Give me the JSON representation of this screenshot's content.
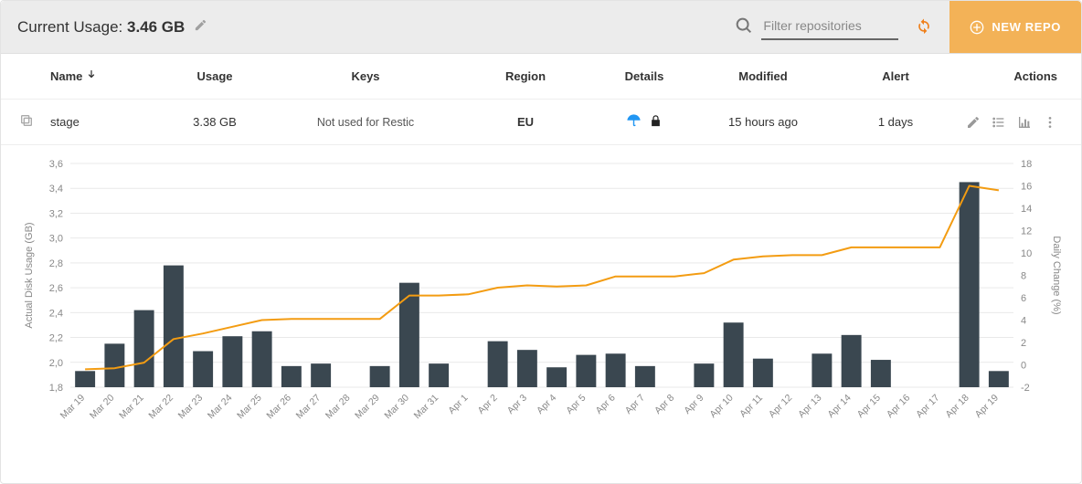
{
  "header": {
    "title_prefix": "Current Usage: ",
    "usage_value": "3.46 GB",
    "search_placeholder": "Filter repositories",
    "new_repo_label": "NEW REPO"
  },
  "columns": {
    "name": "Name",
    "usage": "Usage",
    "keys": "Keys",
    "region": "Region",
    "details": "Details",
    "modified": "Modified",
    "alert": "Alert",
    "actions": "Actions"
  },
  "row": {
    "name": "stage",
    "usage": "3.38 GB",
    "keys": "Not used for Restic",
    "region": "EU",
    "modified": "15 hours ago",
    "alert": "1 days"
  },
  "chart_data": {
    "type": "bar",
    "title": "",
    "xlabel": "",
    "ylabel_left": "Actual Disk Usage (GB)",
    "ylabel_right": "Daily Change (%)",
    "ylim_left": [
      1.8,
      3.6
    ],
    "ylim_right": [
      -2,
      18
    ],
    "categories": [
      "Mar 19",
      "Mar 20",
      "Mar 21",
      "Mar 22",
      "Mar 23",
      "Mar 24",
      "Mar 25",
      "Mar 26",
      "Mar 27",
      "Mar 28",
      "Mar 29",
      "Mar 30",
      "Mar 31",
      "Apr 1",
      "Apr 2",
      "Apr 3",
      "Apr 4",
      "Apr 5",
      "Apr 6",
      "Apr 7",
      "Apr 8",
      "Apr 9",
      "Apr 10",
      "Apr 11",
      "Apr 12",
      "Apr 13",
      "Apr 14",
      "Apr 15",
      "Apr 16",
      "Apr 17",
      "Apr 18",
      "Apr 19"
    ],
    "series": [
      {
        "name": "Actual Disk Usage (GB)",
        "type": "bar",
        "axis": "left",
        "values": [
          1.93,
          2.15,
          2.42,
          2.78,
          2.09,
          2.21,
          2.25,
          1.97,
          1.99,
          null,
          1.97,
          2.64,
          1.99,
          null,
          2.17,
          2.1,
          1.96,
          2.06,
          2.07,
          1.97,
          null,
          1.99,
          2.32,
          2.03,
          null,
          2.07,
          2.22,
          2.02,
          null,
          null,
          3.45,
          1.93
        ]
      },
      {
        "name": "Daily Change (%)",
        "type": "line",
        "axis": "right",
        "values": [
          -0.4,
          -0.3,
          0.2,
          2.3,
          2.8,
          3.4,
          4.0,
          4.1,
          4.1,
          4.1,
          4.1,
          6.2,
          6.2,
          6.3,
          6.9,
          7.1,
          7.0,
          7.1,
          7.9,
          7.9,
          7.9,
          8.2,
          9.4,
          9.7,
          9.8,
          9.8,
          10.5,
          10.5,
          10.5,
          10.5,
          16.0,
          15.6
        ]
      }
    ]
  }
}
